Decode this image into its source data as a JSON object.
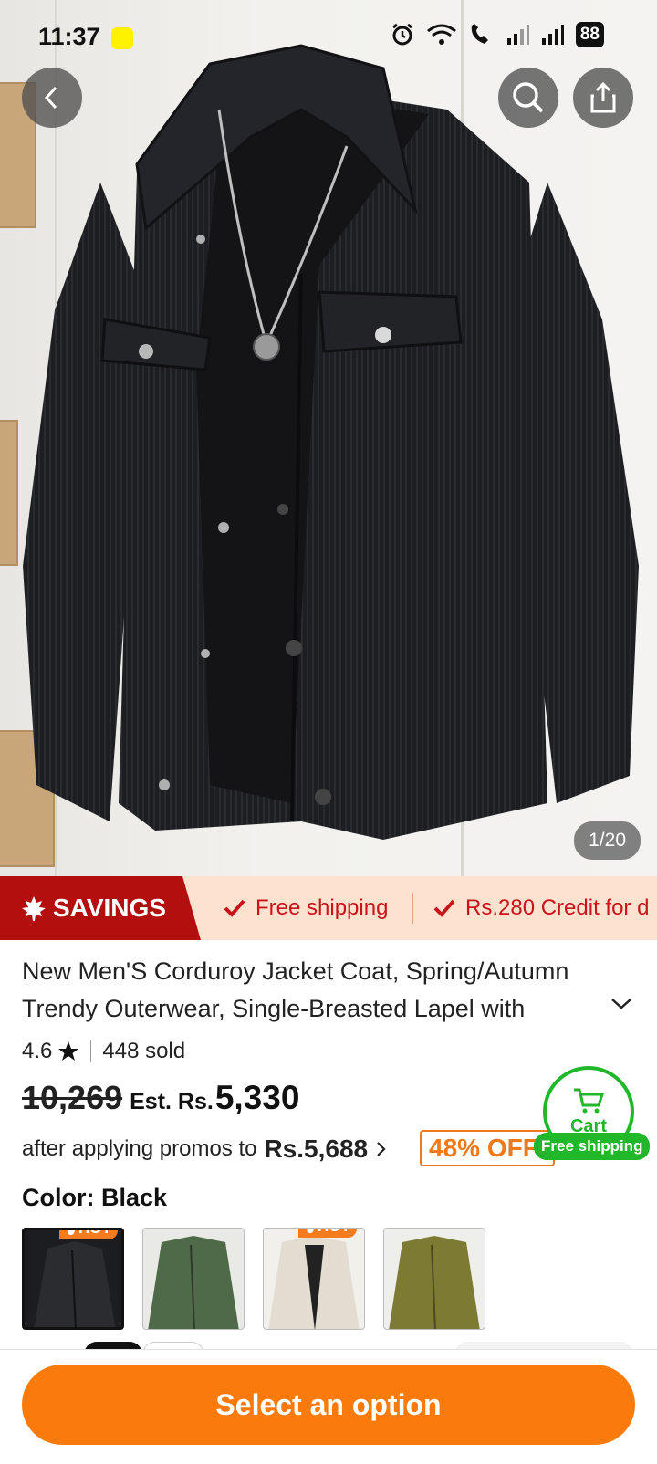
{
  "status_bar": {
    "time": "11:37",
    "battery": "88"
  },
  "gallery": {
    "counter": "1/20"
  },
  "banner": {
    "savings_label": "SAVINGS",
    "perks": [
      "Free shipping",
      "Rs.280 Credit for d"
    ]
  },
  "product": {
    "title": "New Men'S Corduroy Jacket Coat, Spring/Autumn Trendy Outerwear, Single-Breasted Lapel with",
    "rating": "4.6",
    "sold": "448 sold",
    "original_price": "10,269",
    "est_label": "Est. Rs.",
    "est_price": "5,330",
    "promo_text": "after applying promos to",
    "promo_price": "Rs.5,688",
    "discount_badge": "48% OFF"
  },
  "cart": {
    "label": "Cart",
    "shipping": "Free shipping"
  },
  "color": {
    "label": "Color:",
    "selected": "Black",
    "swatches": [
      {
        "name": "Black",
        "hot": "HOT",
        "color": "#1c1d20"
      },
      {
        "name": "Green",
        "hot": "",
        "color": "#4f6a48"
      },
      {
        "name": "Beige",
        "hot": "HOT",
        "color": "#e6e1d6"
      },
      {
        "name": "Olive",
        "hot": "",
        "color": "#7c7a33"
      }
    ]
  },
  "cta": {
    "label": "Select an option"
  },
  "colors": {
    "accent": "#fa7a0c",
    "savings_red": "#b30f0f",
    "green": "#20b72a"
  }
}
